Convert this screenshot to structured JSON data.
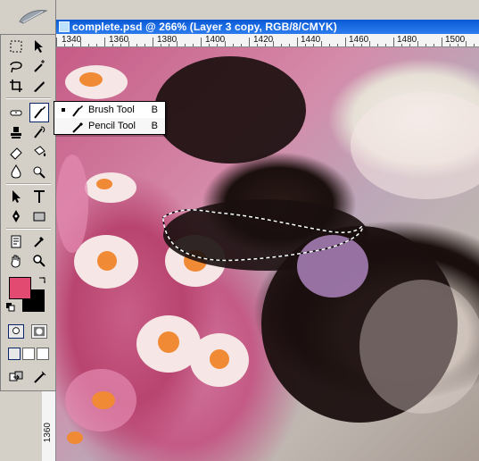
{
  "window": {
    "title": "complete.psd @ 266% (Layer 3 copy, RGB/8/CMYK)"
  },
  "ruler": {
    "top_labels": [
      "1340",
      "1360",
      "1380",
      "1400",
      "1420",
      "1440",
      "1460",
      "1480",
      "1500"
    ],
    "left_labels": [
      "1360"
    ]
  },
  "toolbox": {
    "foreground_color": "#e24a72",
    "background_color": "#000000"
  },
  "flyout": {
    "items": [
      {
        "label": "Brush Tool",
        "shortcut": "B"
      },
      {
        "label": "Pencil Tool",
        "shortcut": "B"
      }
    ]
  }
}
